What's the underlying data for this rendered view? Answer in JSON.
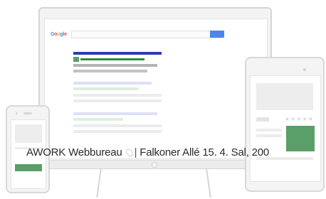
{
  "monitor": {
    "logo": [
      {
        "ch": "G",
        "color": "#4285f4"
      },
      {
        "ch": "o",
        "color": "#ea4335"
      },
      {
        "ch": "o",
        "color": "#fbbc05"
      },
      {
        "ch": "g",
        "color": "#4285f4"
      },
      {
        "ch": "l",
        "color": "#34a853"
      },
      {
        "ch": "e",
        "color": "#ea4335"
      }
    ],
    "accent_blue": "#4b86ea",
    "result_title_color": "#2a3db8",
    "result_url_color": "#2e8b3e"
  },
  "tablet": {
    "stars": "★★★★★",
    "accent_green": "#5a9e6a"
  },
  "caption": {
    "company": "AWORK Webbureau",
    "separator": "|",
    "address": "Falkoner Allé 15. 4. Sal, 200"
  }
}
